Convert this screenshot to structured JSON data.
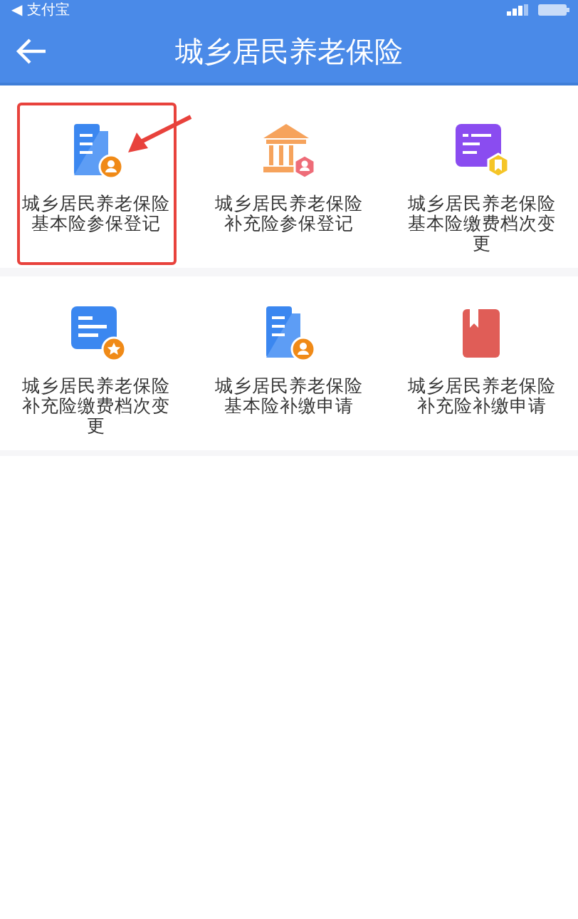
{
  "status_bar": {
    "back_app": "◀ 支付宝"
  },
  "nav": {
    "title": "城乡居民养老保险"
  },
  "services": [
    {
      "label": "城乡居民养老保险基本险参保登记",
      "kind": "building-person",
      "highlighted": true
    },
    {
      "label": "城乡居民养老保险补充险参保登记",
      "kind": "bank-person",
      "highlighted": false
    },
    {
      "label": "城乡居民养老保险基本险缴费档次变更",
      "kind": "list-ribbon",
      "highlighted": false
    },
    {
      "label": "城乡居民养老保险补充险缴费档次变更",
      "kind": "list-star",
      "highlighted": false
    },
    {
      "label": "城乡居民养老保险基本险补缴申请",
      "kind": "building-person",
      "highlighted": false
    },
    {
      "label": "城乡居民养老保险补充险补缴申请",
      "kind": "bookmark-book",
      "highlighted": false
    }
  ]
}
